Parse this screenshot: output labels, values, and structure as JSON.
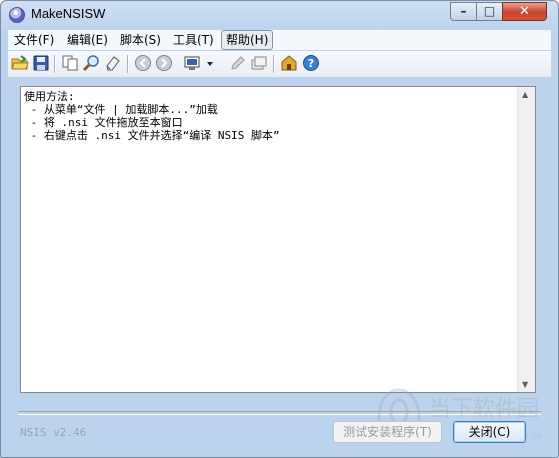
{
  "window": {
    "title": "MakeNSISW"
  },
  "caption_buttons": {
    "minimize": "–",
    "maximize": "□",
    "close": "✕"
  },
  "menu": [
    {
      "label": "文件(F)"
    },
    {
      "label": "编辑(E)"
    },
    {
      "label": "脚本(S)"
    },
    {
      "label": "工具(T)"
    },
    {
      "label": "帮助(H)"
    }
  ],
  "toolbar_icons": [
    "open-folder-icon",
    "save-icon",
    "copy-icon",
    "find-icon",
    "clear-icon",
    "back-icon",
    "forward-icon",
    "run-script-icon",
    "dropdown-arrow-icon",
    "edit-icon",
    "browse-icon",
    "install-icon",
    "help-icon"
  ],
  "editor": {
    "lines": [
      "使用方法:",
      "",
      " - 从菜单“文件 | 加载脚本...”加载",
      " - 将 .nsi 文件拖放至本窗口",
      " - 右键点击 .nsi 文件并选择“编译 NSIS 脚本”"
    ]
  },
  "status": {
    "version": "NSIS v2.46"
  },
  "buttons": {
    "test": "测试安装程序(T)",
    "close": "关闭(C)"
  },
  "watermark": {
    "text": "当下软件园",
    "url": "www.downxia.com"
  },
  "colors": {
    "title_bar": "#bcd3ee",
    "close_button": "#c7442b",
    "default_button_border": "#3c7fb1"
  }
}
